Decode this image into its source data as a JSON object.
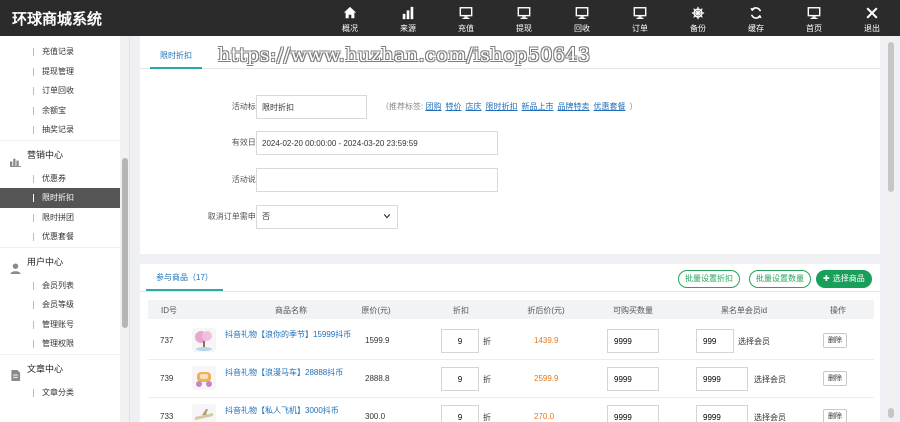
{
  "app": {
    "title": "环球商城系统"
  },
  "topnav": [
    {
      "label": "概况",
      "icon": "home-icon"
    },
    {
      "label": "来源",
      "icon": "bar-chart-icon"
    },
    {
      "label": "充值",
      "icon": "monitor-icon"
    },
    {
      "label": "提现",
      "icon": "monitor-icon"
    },
    {
      "label": "回收",
      "icon": "monitor-icon"
    },
    {
      "label": "订单",
      "icon": "monitor-icon"
    },
    {
      "label": "备份",
      "icon": "helm-icon"
    },
    {
      "label": "缓存",
      "icon": "refresh-icon"
    },
    {
      "label": "首页",
      "icon": "monitor-icon"
    },
    {
      "label": "退出",
      "icon": "close-icon"
    }
  ],
  "sidebar": {
    "top_items": [
      "充值记录",
      "提现管理",
      "订单回收",
      "余额宝",
      "抽奖记录"
    ],
    "groups": [
      {
        "label": "营销中心",
        "icon": "chart-icon",
        "items": [
          "优惠券",
          "限时折扣",
          "限时拼团",
          "优惠套餐"
        ]
      },
      {
        "label": "用户中心",
        "icon": "user-icon",
        "items": [
          "会员列表",
          "会员等级",
          "管理账号",
          "管理权限"
        ]
      },
      {
        "label": "文章中心",
        "icon": "document-icon",
        "items": [
          "文章分类"
        ]
      }
    ],
    "active": "限时折扣"
  },
  "form": {
    "tab": "限时折扣",
    "watermark": "https://www.huzhan.com/ishop50643",
    "tag_label": "活动标签:",
    "tag_value": "限时折扣",
    "recommend_prefix": "（推荐标签:",
    "recommend_tags": [
      "团购",
      "特价",
      "店庆",
      "限时折扣",
      "新品上市",
      "品牌特卖",
      "优惠套餐"
    ],
    "recommend_suffix": "）",
    "date_label": "有效日期:",
    "date_value": "2024-02-20 00:00:00 - 2024-03-20 23:59:59",
    "desc_label": "活动说明:",
    "desc_value": "",
    "cancel_label": "取消订单需申请:",
    "cancel_value": "否"
  },
  "products": {
    "tab": "参与商品（17）",
    "batch_discount": "批量设置折扣",
    "batch_quantity": "批量设置数量",
    "select_button": "选择商品",
    "headers": [
      "ID号",
      "商品名称",
      "原价(元)",
      "折扣",
      "折后价(元)",
      "可购买数量",
      "黑名单会员id",
      "操作"
    ],
    "discount_unit": "折",
    "select_member": "选择会员",
    "delete_label": "删除",
    "rows": [
      {
        "id": "737",
        "name": "抖音礼物【浪你的季节】15999抖币",
        "price": "1599.9",
        "discount": "9",
        "after": "1439.9",
        "qty": "9999",
        "blacklist": "999"
      },
      {
        "id": "739",
        "name": "抖音礼物【浪漫马车】28888抖币",
        "price": "2888.8",
        "discount": "9",
        "after": "2599.9",
        "qty": "9999",
        "blacklist": "9999"
      },
      {
        "id": "733",
        "name": "抖音礼物【私人飞机】3000抖币",
        "price": "300.0",
        "discount": "9",
        "after": "270.0",
        "qty": "9999",
        "blacklist": "9999"
      }
    ]
  },
  "colors": {
    "topbar": "#2b2b2b",
    "accent": "#18a05a",
    "link": "#1e6fb8",
    "price_after": "#e07a1f"
  }
}
